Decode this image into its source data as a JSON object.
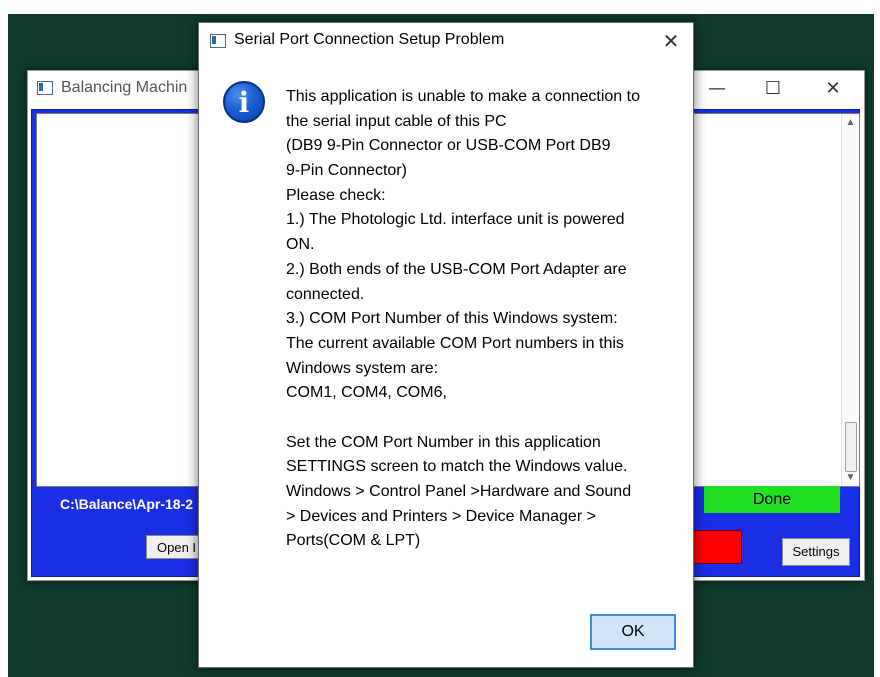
{
  "background_window": {
    "title": "Balancing Machin",
    "controls": {
      "minimize": "—",
      "maximize": "☐",
      "close": "✕"
    },
    "path_label": "C:\\Balance\\Apr-18-2",
    "open_button": "Open I",
    "done_label": "Done",
    "settings_button": "Settings"
  },
  "dialog": {
    "title": "Serial Port Connection Setup Problem",
    "close_glyph": "✕",
    "info_glyph": "i",
    "message_lines": [
      "This application is unable to make a connection to",
      "the serial input cable of this PC",
      "(DB9 9-Pin Connector  or USB-COM Port DB9",
      "9-Pin Connector)",
      "Please check:",
      "1.) The Photologic Ltd. interface unit is powered",
      "ON.",
      "2.) Both ends of the USB-COM Port Adapter are",
      "connected.",
      "3.) COM Port Number of this Windows system:",
      "The current available COM Port numbers in this",
      "Windows system are:",
      "COM1, COM4, COM6,",
      "",
      "Set the COM Port Number in this application",
      "SETTINGS screen to match the Windows value.",
      "Windows > Control Panel >Hardware and Sound",
      "> Devices and Printers > Device Manager >",
      "Ports(COM & LPT)"
    ],
    "ok_button": "OK"
  },
  "colors": {
    "desktop": "#0f3a2e",
    "app_blue": "#1a2ee6",
    "done_green": "#22e022",
    "status_red": "#ff0000",
    "ok_button_bg": "#cfe6fb"
  },
  "icons": [
    "app-window-icon",
    "info-icon",
    "close-icon",
    "minimize-icon",
    "maximize-icon"
  ]
}
